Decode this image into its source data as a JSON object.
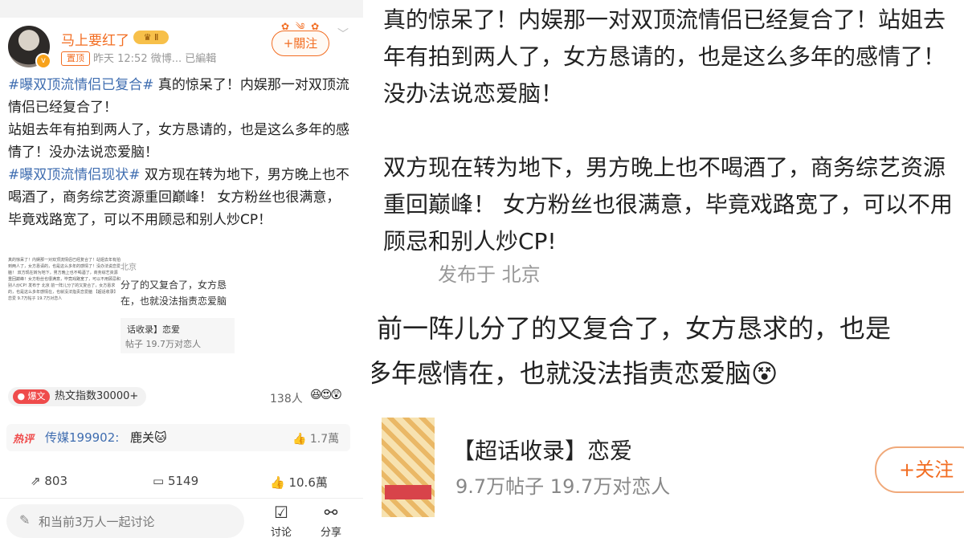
{
  "left": {
    "username": "马上要红了",
    "level_badge": "♛ Ⅱ",
    "pin_tag": "置顶",
    "meta": "昨天 12:52 微博... 已編輯",
    "follow_label": "+關注",
    "post": {
      "tag1": "#曝双顶流情侣已复合#",
      "text1": " 真的惊呆了！内娱那一对双顶流情侣已经复合了！",
      "text2": "站姐去年有拍到两人了，女方恳请的，也是这么多年的感情了！没办法说恋爱脑！",
      "tag2": "#曝双顶流情侣现状#",
      "text3": " 双方现在转为地下，男方晚上也不喝酒了，商务综艺资源重回巅峰！ 女方粉丝也很满意，毕竟戏路宽了，可以不用顾忌和别人炒CP！"
    },
    "thumbnail": {
      "small_lines": "真的惊呆了！内娱那一对双顶流情侣已经复合了！站姐去年有拍到两人了，女方恳请的，也是这么多年的感情了！没办法说恋爱脑！ 双方现在转为地下，男方晚上也不喝酒了，商务综艺资源重回巅峰！女方粉丝也很满意，毕竟戏路宽了，可以不用顾忌和别人炒CP! 发布于 北京 前一阵儿分了的又复合了，女方恳求的，也是这么多年感情在，也就没法指责恋爱脑 【超话收录】恋爱 9.7万帖子 19.7万对恋人",
      "location": "北京",
      "line1": "分了的又复合了，女方恳",
      "line2": "在，也就没法指责恋爱脑",
      "card_title": "话收录】恋爱",
      "card_stats": "帖子 19.7万对恋人"
    },
    "hot_badge": "爆文",
    "hot_index": "热文指数30000+",
    "people_count": "138人",
    "hot_comment": {
      "tag": "热评",
      "user": "传媒199902:",
      "text": "鹿关🐱",
      "likes": "1.7萬"
    },
    "actions": {
      "repost_count": "803",
      "comment_count": "5149",
      "like_count": "10.6萬"
    },
    "discuss_placeholder": "和当前3万人一起讨论",
    "discuss_label": "讨论",
    "share_label": "分享"
  },
  "right": {
    "para1": "真的惊呆了！内娱那一对双顶流情侣已经复合了！站姐去年有拍到两人了，女方恳请的，也是这么多年的感情了！没办法说恋爱脑！",
    "para2": "双方现在转为地下，男方晚上也不喝酒了，商务综艺资源重回巅峰！ 女方粉丝也很满意，毕竟戏路宽了，可以不用顾忌和别人炒CP!",
    "location": "发布于 北京",
    "crop_line1": "前一阵儿分了的又复合了，女方恳求的，也是",
    "crop_line2": "多年感情在，也就没法指责恋爱脑😵",
    "card_title": "【超话收录】恋爱",
    "card_stats": "9.7万帖子 19.7万对恋人",
    "card_follow": "+关注"
  },
  "colors": {
    "accent": "#f26d22",
    "link": "#3f6db0",
    "hot": "#ef4b4b"
  }
}
